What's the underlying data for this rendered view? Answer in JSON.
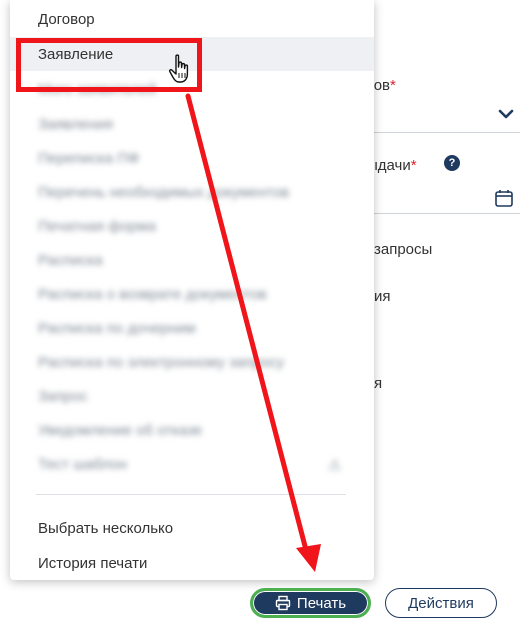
{
  "background": {
    "field1_label": "тов",
    "field1_required": "*",
    "field2_label": "ыдачи",
    "field2_required": "*",
    "help_symbol": "?",
    "text_requests": "запросы",
    "text_ia1": "ия",
    "text_ia2": "я"
  },
  "menu": {
    "items": [
      {
        "label": "Договор",
        "blurred": false
      },
      {
        "label": "Заявление",
        "blurred": false
      },
      {
        "label": "Мого заявителей",
        "blurred": true
      },
      {
        "label": "Заявления",
        "blurred": true
      },
      {
        "label": "Переписка ПФ",
        "blurred": true
      },
      {
        "label": "Перечень необходимых документов",
        "blurred": true
      },
      {
        "label": "Печатная форма",
        "blurred": true
      },
      {
        "label": "Расписка",
        "blurred": true
      },
      {
        "label": "Расписка о возврате документов",
        "blurred": true
      },
      {
        "label": "Расписка по дочерним",
        "blurred": true
      },
      {
        "label": "Расписка по электронному запросу",
        "blurred": true
      },
      {
        "label": "Запрос",
        "blurred": true
      },
      {
        "label": "Уведомление об отказе",
        "blurred": true
      },
      {
        "label": "Тест шаблон",
        "blurred": true
      }
    ],
    "select_multiple": "Выбрать несколько",
    "print_history": "История печати"
  },
  "buttons": {
    "print_label": "Печать",
    "actions_label": "Действия"
  },
  "annotation_color": "#f0151a"
}
